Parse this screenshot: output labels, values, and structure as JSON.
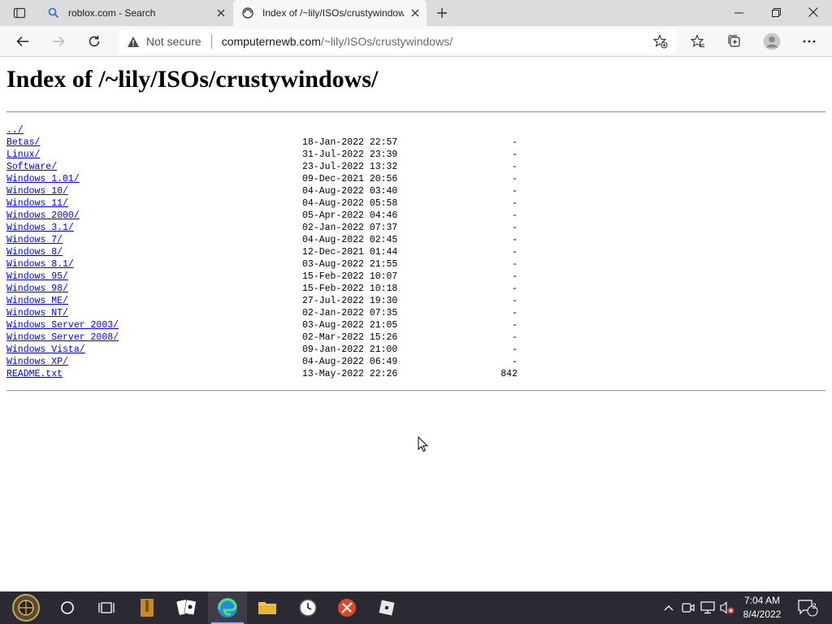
{
  "tabs": [
    {
      "title": "roblox.com - Search"
    },
    {
      "title": "Index of /~lily/ISOs/crustywindows/"
    }
  ],
  "address": {
    "security_label": "Not secure",
    "host": "computernewb.com",
    "path": "/~lily/ISOs/crustywindows/"
  },
  "page": {
    "heading": "Index of /~lily/ISOs/crustywindows/",
    "entries": [
      {
        "name": "../",
        "date": "",
        "size": ""
      },
      {
        "name": "Betas/",
        "date": "18-Jan-2022 22:57",
        "size": "-"
      },
      {
        "name": "Linux/",
        "date": "31-Jul-2022 23:39",
        "size": "-"
      },
      {
        "name": "Software/",
        "date": "23-Jul-2022 13:32",
        "size": "-"
      },
      {
        "name": "Windows 1.01/",
        "date": "09-Dec-2021 20:56",
        "size": "-"
      },
      {
        "name": "Windows 10/",
        "date": "04-Aug-2022 03:40",
        "size": "-"
      },
      {
        "name": "Windows 11/",
        "date": "04-Aug-2022 05:58",
        "size": "-"
      },
      {
        "name": "Windows 2000/",
        "date": "05-Apr-2022 04:46",
        "size": "-"
      },
      {
        "name": "Windows 3.1/",
        "date": "02-Jan-2022 07:37",
        "size": "-"
      },
      {
        "name": "Windows 7/",
        "date": "04-Aug-2022 02:45",
        "size": "-"
      },
      {
        "name": "Windows 8/",
        "date": "12-Dec-2021 01:44",
        "size": "-"
      },
      {
        "name": "Windows 8.1/",
        "date": "03-Aug-2022 21:55",
        "size": "-"
      },
      {
        "name": "Windows 95/",
        "date": "15-Feb-2022 10:07",
        "size": "-"
      },
      {
        "name": "Windows 98/",
        "date": "15-Feb-2022 10:18",
        "size": "-"
      },
      {
        "name": "Windows ME/",
        "date": "27-Jul-2022 19:30",
        "size": "-"
      },
      {
        "name": "Windows NT/",
        "date": "02-Jan-2022 07:35",
        "size": "-"
      },
      {
        "name": "Windows Server 2003/",
        "date": "03-Aug-2022 21:05",
        "size": "-"
      },
      {
        "name": "Windows Server 2008/",
        "date": "02-Mar-2022 15:26",
        "size": "-"
      },
      {
        "name": "Windows Vista/",
        "date": "09-Jan-2022 21:00",
        "size": "-"
      },
      {
        "name": "Windows XP/",
        "date": "04-Aug-2022 06:49",
        "size": "-"
      },
      {
        "name": "README.txt",
        "date": "13-May-2022 22:26",
        "size": "842"
      }
    ]
  },
  "taskbar": {
    "apps": [
      "start-icon",
      "cortana-icon",
      "task-view-icon",
      "archive-app-icon",
      "solitaire-icon",
      "edge-icon",
      "file-explorer-icon",
      "clock-app-icon",
      "tool-app-icon",
      "roblox-icon"
    ],
    "time": "7:04 AM",
    "date": "8/4/2022",
    "notification_count": "2"
  },
  "colors": {
    "link": "#0000ee",
    "taskbar": "#2b2a33",
    "tabstrip": "#dcdcdc"
  }
}
